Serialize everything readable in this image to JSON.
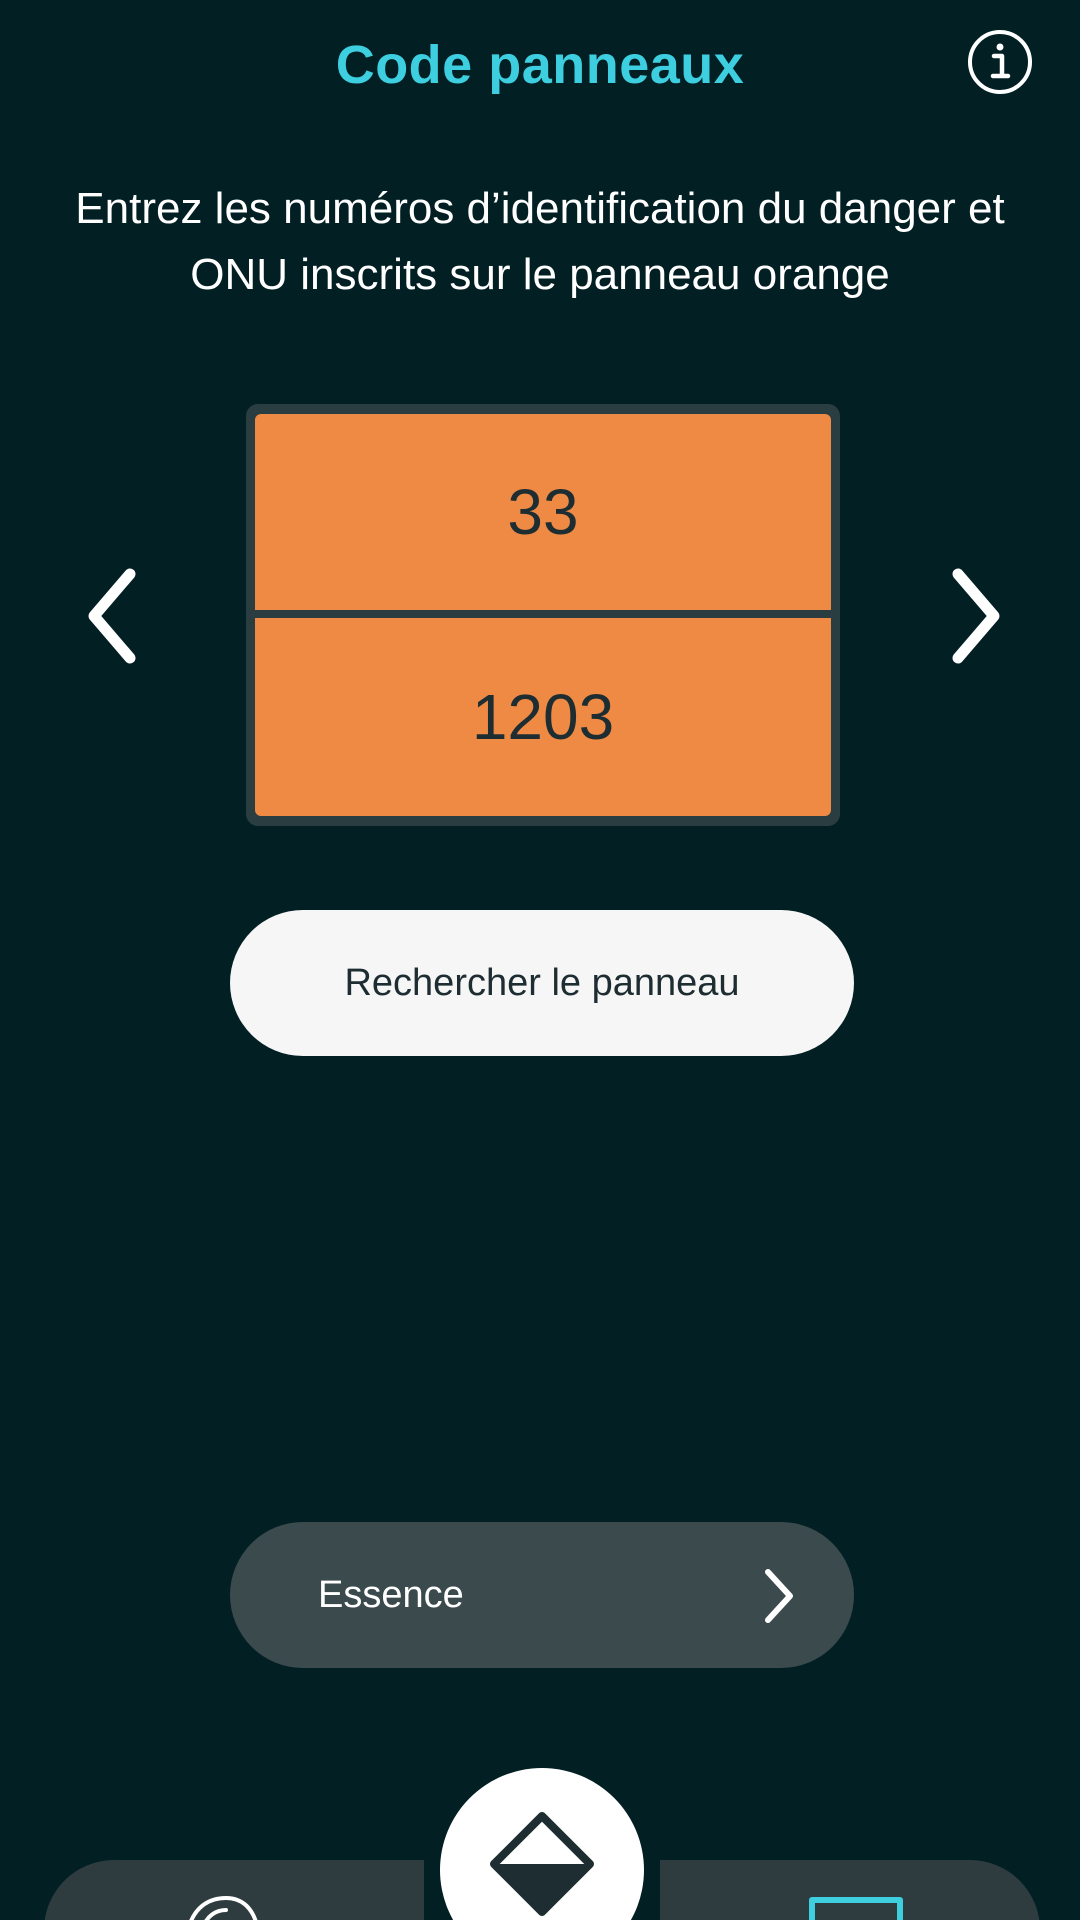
{
  "header": {
    "title": "Code panneaux",
    "info_icon": "info-circle-icon"
  },
  "instruction": "Entrez les numéros d’identification du danger et ONU inscrits sur le panneau orange",
  "plate": {
    "hazard_number": "33",
    "un_number": "1203",
    "color": "#ef8a45"
  },
  "navigation": {
    "prev_icon": "chevron-left-icon",
    "next_icon": "chevron-right-icon"
  },
  "search_button": {
    "label": "Rechercher le panneau"
  },
  "result": {
    "label": "Essence",
    "icon": "chevron-right-icon"
  },
  "bottom_nav": {
    "left_icon": "partial-icon",
    "center_icon": "hazard-diamond-icon",
    "right_icon": "partial-square-icon"
  },
  "colors": {
    "background": "#021f23",
    "accent": "#3dcfe0",
    "plate_orange": "#ef8a45",
    "pill_dark": "#3b4a4d"
  }
}
